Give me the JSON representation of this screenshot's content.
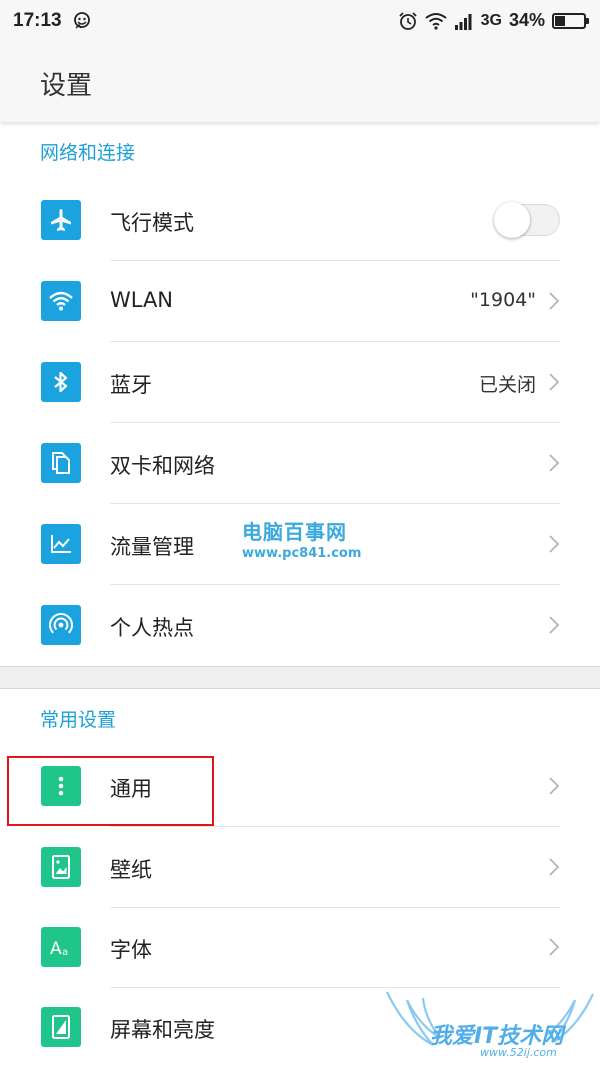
{
  "status_bar": {
    "time": "17:13",
    "network": "3G",
    "battery_percent_text": "34%",
    "battery_level": 0.34,
    "icons": [
      "notification-emoji-icon",
      "alarm-icon",
      "wifi-icon",
      "signal-icon",
      "battery-icon"
    ]
  },
  "header": {
    "title": "设置"
  },
  "sections": [
    {
      "title": "网络和连接",
      "items": [
        {
          "label": "飞行模式",
          "icon": "airplane-icon",
          "icon_color": "#1aa3df",
          "toggle": false
        },
        {
          "label": "WLAN",
          "value": "\"1904\"",
          "icon": "wifi-icon",
          "icon_color": "#1aa3df"
        },
        {
          "label": "蓝牙",
          "value": "已关闭",
          "icon": "bluetooth-icon",
          "icon_color": "#1aa3df"
        },
        {
          "label": "双卡和网络",
          "icon": "sim-cards-icon",
          "icon_color": "#1aa3df"
        },
        {
          "label": "流量管理",
          "icon": "data-usage-icon",
          "icon_color": "#1aa3df"
        },
        {
          "label": "个人热点",
          "icon": "hotspot-icon",
          "icon_color": "#1aa3df"
        }
      ]
    },
    {
      "title": "常用设置",
      "items": [
        {
          "label": "通用",
          "icon": "more-vertical-icon",
          "icon_color": "#1fc58a"
        },
        {
          "label": "壁纸",
          "icon": "wallpaper-icon",
          "icon_color": "#1fc58a"
        },
        {
          "label": "字体",
          "icon": "font-icon",
          "icon_color": "#1fc58a",
          "icon_text": "Aa"
        },
        {
          "label": "屏幕和亮度",
          "icon": "display-brightness-icon",
          "icon_color": "#1fc58a"
        }
      ]
    }
  ],
  "watermarks": {
    "pc841_title": "电脑百事网",
    "pc841_url": "www.pc841.com",
    "site_title": "我爱IT技术网",
    "site_url": "www.52ij.com"
  },
  "colors": {
    "section_title": "#1da1d6",
    "highlight_border": "#e0141c"
  }
}
